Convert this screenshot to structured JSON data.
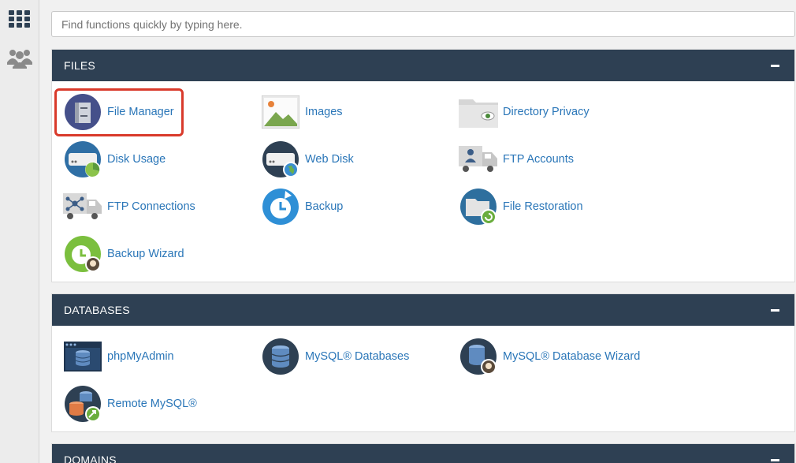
{
  "search": {
    "placeholder": "Find functions quickly by typing here."
  },
  "sidebar": {
    "items": [
      {
        "icon": "grid-icon"
      },
      {
        "icon": "users-icon"
      }
    ]
  },
  "sections": {
    "files": {
      "title": "FILES",
      "items": {
        "file_manager": "File Manager",
        "images": "Images",
        "directory_privacy": "Directory Privacy",
        "disk_usage": "Disk Usage",
        "web_disk": "Web Disk",
        "ftp_accounts": "FTP Accounts",
        "ftp_connections": "FTP Connections",
        "backup": "Backup",
        "file_restoration": "File Restoration",
        "backup_wizard": "Backup Wizard"
      }
    },
    "databases": {
      "title": "DATABASES",
      "items": {
        "phpmyadmin": "phpMyAdmin",
        "mysql_databases": "MySQL® Databases",
        "mysql_database_wizard": "MySQL® Database Wizard",
        "remote_mysql": "Remote MySQL®"
      }
    },
    "domains": {
      "title": "DOMAINS"
    }
  },
  "colors": {
    "panel_header": "#2e4053",
    "link": "#2a76b8",
    "highlight": "#d93a2b"
  }
}
